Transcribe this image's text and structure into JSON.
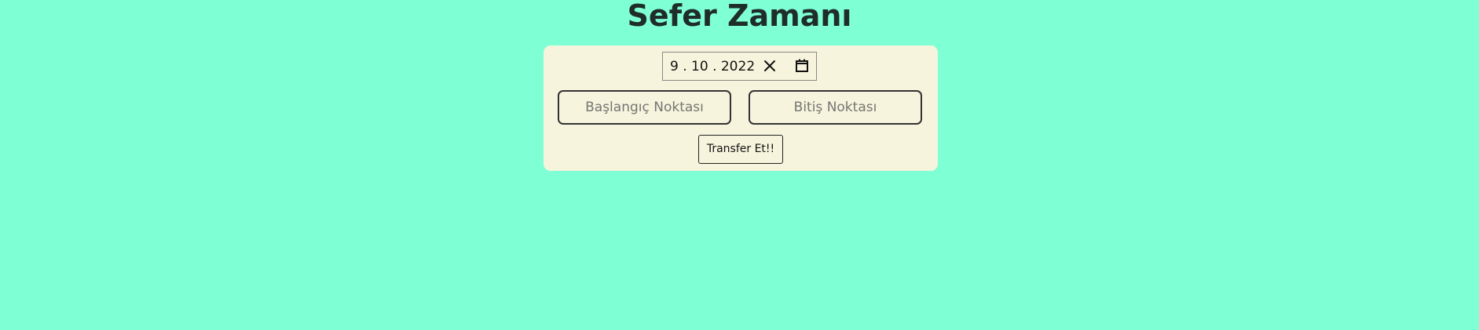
{
  "page": {
    "title": "Sefer Zamanı",
    "background_color": "#7fffd4",
    "card_color": "#f6f4dc"
  },
  "form": {
    "date": {
      "value": "9 . 10 . 2022",
      "clear_icon": "close-icon",
      "calendar_icon": "calendar-icon"
    },
    "start_field": {
      "placeholder": "Başlangıç Noktası",
      "value": ""
    },
    "end_field": {
      "placeholder": "Bitiş Noktası",
      "value": ""
    },
    "submit_label": "Transfer Et!!"
  }
}
